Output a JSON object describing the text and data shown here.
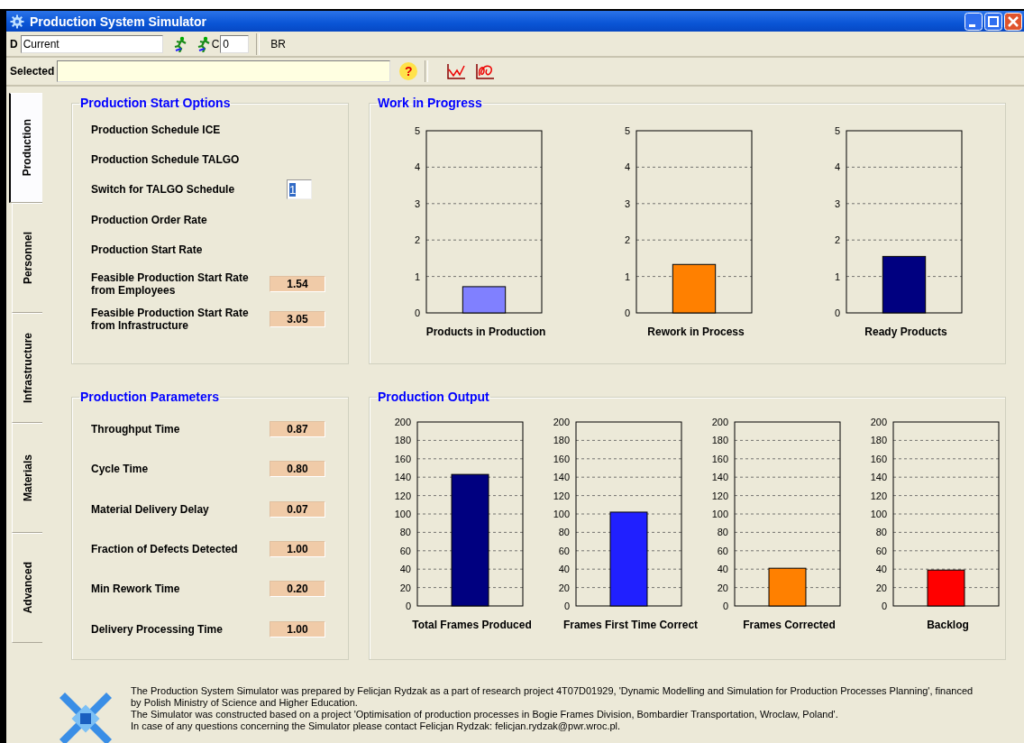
{
  "window": {
    "title": "Production System Simulator"
  },
  "toolbar": {
    "d_label": "D",
    "d_field": {
      "value": "Current"
    },
    "c_label": "C",
    "c_field": {
      "value": "0"
    },
    "br_label": "BR",
    "selected_label": "Selected",
    "help_button": {
      "label": "?"
    }
  },
  "tabs": [
    {
      "label": "Production",
      "selected": true
    },
    {
      "label": "Personnel",
      "selected": false
    },
    {
      "label": "Infrastructure",
      "selected": false
    },
    {
      "label": "Materials",
      "selected": false
    },
    {
      "label": "Advanced",
      "selected": false
    }
  ],
  "start_options": {
    "title": "Production Start Options",
    "rows": [
      {
        "kind": "text",
        "label": "Production Schedule ICE"
      },
      {
        "kind": "text",
        "label": "Production Schedule TALGO"
      },
      {
        "kind": "input",
        "label": "Switch for TALGO Schedule",
        "value": "1",
        "text_selected": true
      },
      {
        "kind": "text",
        "label": "Production Order Rate"
      },
      {
        "kind": "text",
        "label": "Production Start Rate"
      },
      {
        "kind": "value",
        "label": "Feasible Production Start Rate from Employees",
        "value": "1.54"
      },
      {
        "kind": "value",
        "label": "Feasible Production Start Rate from Infrastructure",
        "value": "3.05"
      }
    ]
  },
  "parameters": {
    "title": "Production Parameters",
    "rows": [
      {
        "kind": "value",
        "label": "Throughput Time",
        "value": "0.87"
      },
      {
        "kind": "value",
        "label": "Cycle Time",
        "value": "0.80"
      },
      {
        "kind": "value",
        "label": "Material Delivery Delay",
        "value": "0.07"
      },
      {
        "kind": "value",
        "label": "Fraction of Defects Detected",
        "value": "1.00"
      },
      {
        "kind": "value",
        "label": "Min Rework Time",
        "value": "0.20"
      },
      {
        "kind": "value",
        "label": "Delivery Processing Time",
        "value": "1.00"
      }
    ]
  },
  "work_in_progress": {
    "title": "Work in Progress",
    "charts": [
      {
        "chart_data": {
          "type": "bar",
          "xlabel": "Products in Production",
          "grid": true,
          "ylim": [
            0,
            5
          ],
          "yticks": [
            0,
            1,
            2,
            3,
            4,
            5
          ],
          "series": [
            {
              "color": "#8080ff",
              "values": [
                0.72
              ]
            }
          ]
        }
      },
      {
        "chart_data": {
          "type": "bar",
          "xlabel": "Rework in Process",
          "grid": true,
          "ylim": [
            0,
            5
          ],
          "yticks": [
            0,
            1,
            2,
            3,
            4,
            5
          ],
          "series": [
            {
              "color": "#ff8000",
              "values": [
                1.33
              ]
            }
          ]
        }
      },
      {
        "chart_data": {
          "type": "bar",
          "xlabel": "Ready Products",
          "grid": true,
          "ylim": [
            0,
            5
          ],
          "yticks": [
            0,
            1,
            2,
            3,
            4,
            5
          ],
          "series": [
            {
              "color": "#000080",
              "values": [
                1.55
              ]
            }
          ]
        }
      }
    ]
  },
  "production_output": {
    "title": "Production Output",
    "charts": [
      {
        "chart_data": {
          "type": "bar",
          "xlabel": "Total Frames Produced",
          "grid": true,
          "ylim": [
            0,
            200
          ],
          "yticks": [
            0,
            20,
            40,
            60,
            80,
            100,
            120,
            140,
            160,
            180,
            200
          ],
          "series": [
            {
              "color": "#000080",
              "values": [
                143
              ]
            }
          ]
        }
      },
      {
        "chart_data": {
          "type": "bar",
          "xlabel": "Frames First Time Correct",
          "grid": true,
          "ylim": [
            0,
            200
          ],
          "yticks": [
            0,
            20,
            40,
            60,
            80,
            100,
            120,
            140,
            160,
            180,
            200
          ],
          "series": [
            {
              "color": "#2020ff",
              "values": [
                102
              ]
            }
          ]
        }
      },
      {
        "chart_data": {
          "type": "bar",
          "xlabel": "Frames Corrected",
          "grid": true,
          "ylim": [
            0,
            200
          ],
          "yticks": [
            0,
            20,
            40,
            60,
            80,
            100,
            120,
            140,
            160,
            180,
            200
          ],
          "series": [
            {
              "color": "#ff8000",
              "values": [
                41
              ]
            }
          ]
        }
      },
      {
        "chart_data": {
          "type": "bar",
          "xlabel": "Backlog",
          "grid": true,
          "ylim": [
            0,
            200
          ],
          "yticks": [
            0,
            20,
            40,
            60,
            80,
            100,
            120,
            140,
            160,
            180,
            200
          ],
          "series": [
            {
              "color": "#ff0000",
              "values": [
                39
              ]
            }
          ]
        }
      }
    ]
  },
  "footer": {
    "paragraphs": [
      "The Production System Simulator was prepared by Felicjan Rydzak as a part of research project 4T07D01929, 'Dynamic Modelling and Simulation for Production Processes Planning', financed by Polish Ministry of Science and Higher Education.",
      "The Simulator was constructed based on a project 'Optimisation of production processes in Bogie Frames Division, Bombardier Transportation, Wroclaw, Poland'.",
      "In case of any questions concerning the Simulator please contact Felicjan Rydzak: felicjan.rydzak@pwr.wroc.pl."
    ]
  }
}
